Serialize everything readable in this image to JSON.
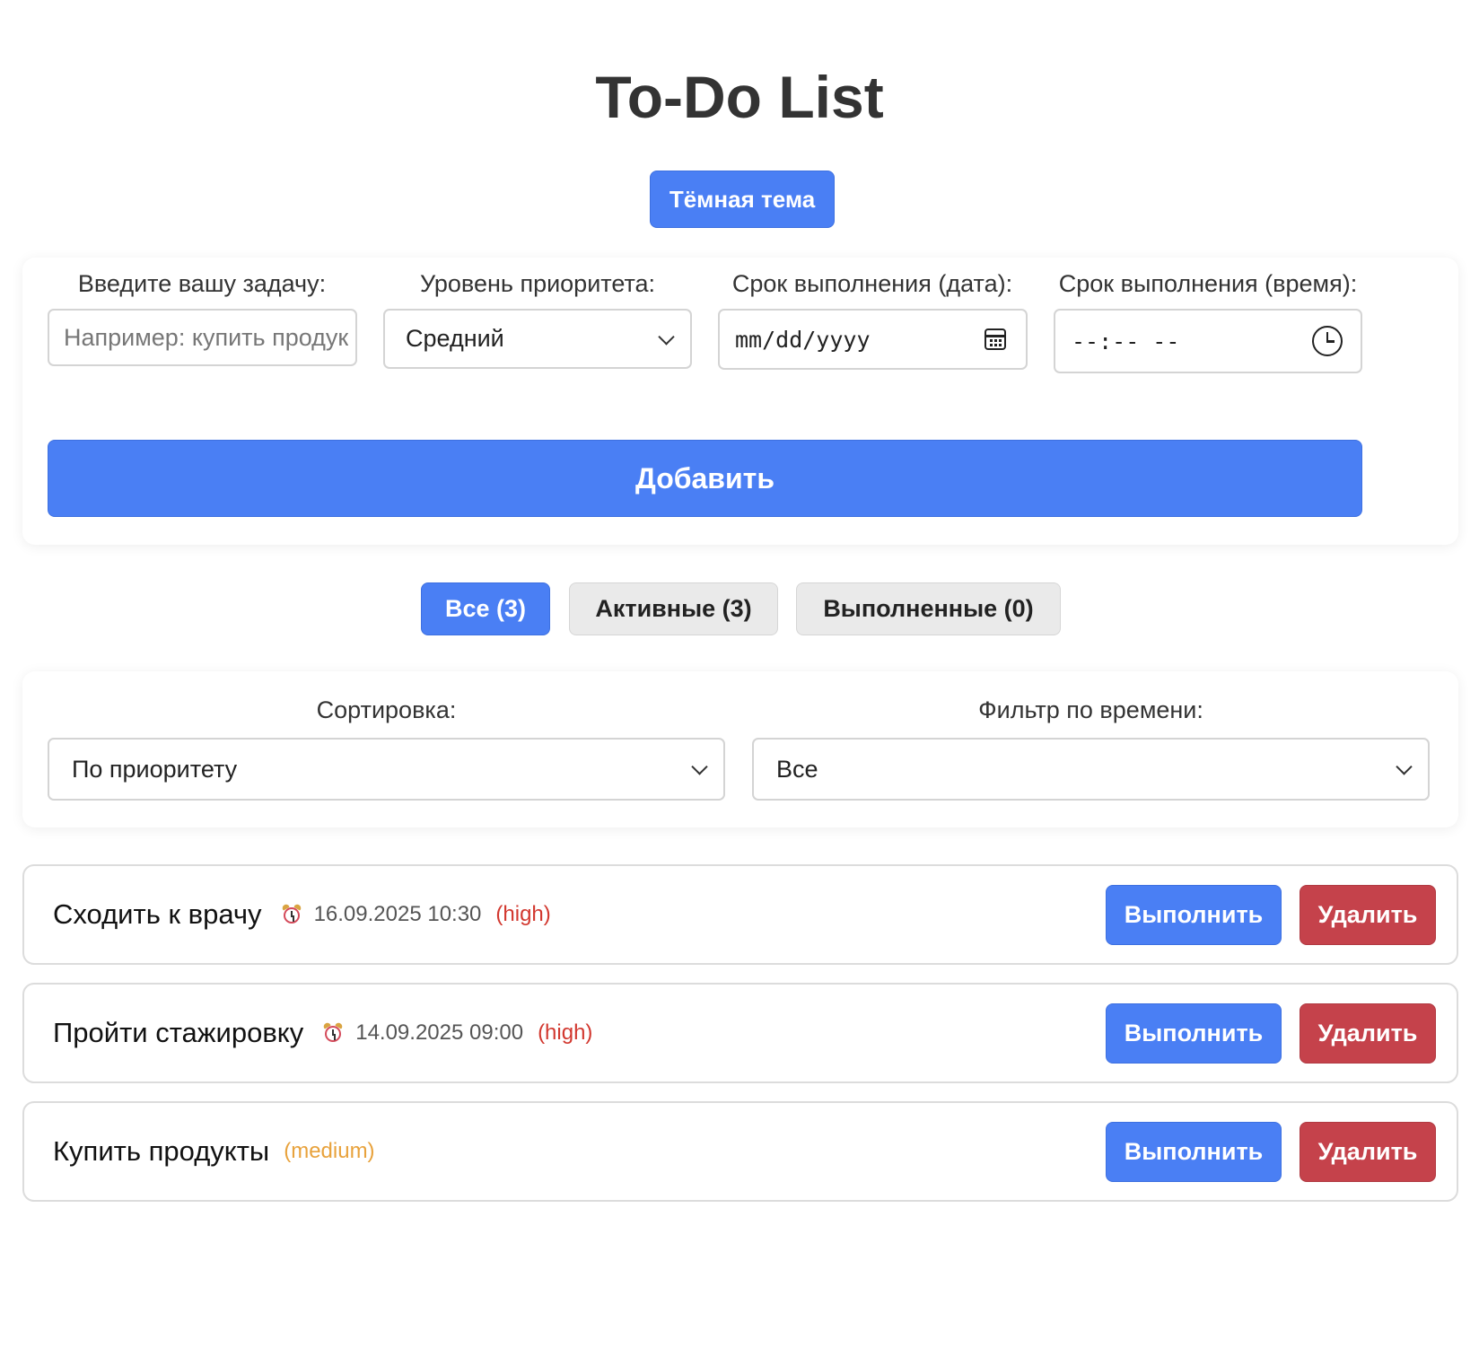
{
  "app": {
    "title": "To-Do List",
    "theme_toggle_label": "Тёмная тема"
  },
  "form": {
    "task": {
      "label": "Введите вашу задачу:",
      "placeholder": "Например: купить продук",
      "value": ""
    },
    "priority": {
      "label": "Уровень приоритета:",
      "value": "Средний"
    },
    "due_date": {
      "label": "Срок выполнения (дата):",
      "value": "mm/dd/yyyy"
    },
    "due_time": {
      "label": "Срок выполнения (время):",
      "value": "--:-- --"
    },
    "add_label": "Добавить"
  },
  "tabs": [
    {
      "label": "Все (3)",
      "active": true
    },
    {
      "label": "Активные (3)",
      "active": false
    },
    {
      "label": "Выполненные (0)",
      "active": false
    }
  ],
  "controls": {
    "sort": {
      "label": "Сортировка:",
      "value": "По приоритету"
    },
    "time_filter": {
      "label": "Фильтр по времени:",
      "value": "Все"
    }
  },
  "tasks": [
    {
      "title": "Сходить к врачу",
      "alarm_icon": "alarm-clock-icon",
      "due": "16.09.2025 10:30",
      "priority": "(high)",
      "priority_color": "#d2382f"
    },
    {
      "title": "Пройти стажировку",
      "alarm_icon": "alarm-clock-icon",
      "due": "14.09.2025 09:00",
      "priority": "(high)",
      "priority_color": "#d2382f"
    },
    {
      "title": "Купить продукты",
      "due": "",
      "priority": "(medium)",
      "priority_color": "#e8a23c"
    }
  ],
  "task_actions": {
    "complete_label": "Выполнить",
    "delete_label": "Удалить"
  },
  "colors": {
    "accent": "#4a7ff4",
    "danger": "#c5424b"
  }
}
